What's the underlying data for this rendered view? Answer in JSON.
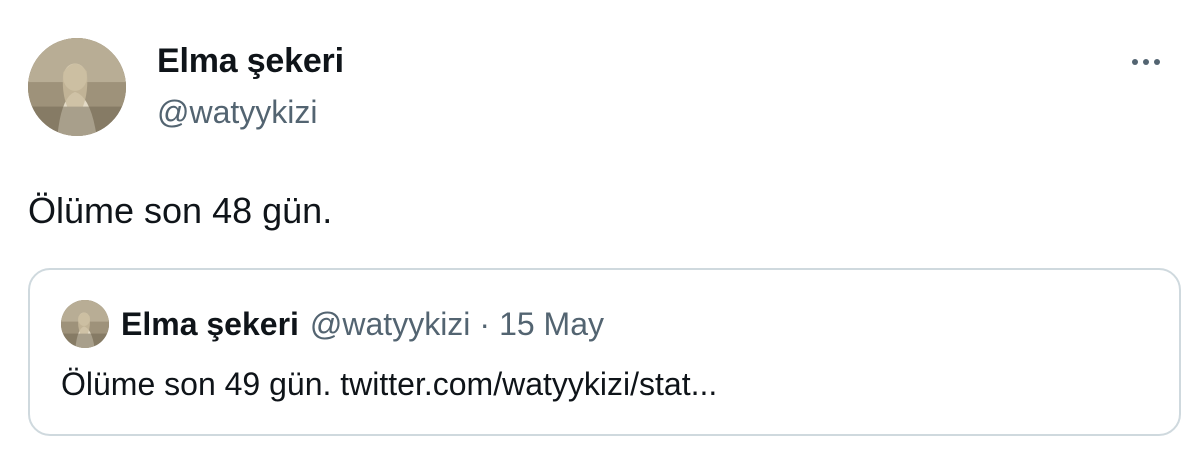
{
  "author": {
    "name": "Elma şekeri",
    "handle": "@watyykizi"
  },
  "tweet": {
    "text": "Ölüme son 48 gün."
  },
  "quoted_tweet": {
    "name": "Elma şekeri",
    "handle": "@watyykizi",
    "separator": "·",
    "date": "15 May",
    "text": "Ölüme son 49 gün. twitter.com/watyykizi/stat..."
  },
  "icons": {
    "more": "more-horizontal-icon"
  },
  "colors": {
    "text_primary": "#0f1419",
    "text_secondary": "#536471",
    "border": "#cfd9de",
    "background": "#ffffff"
  }
}
